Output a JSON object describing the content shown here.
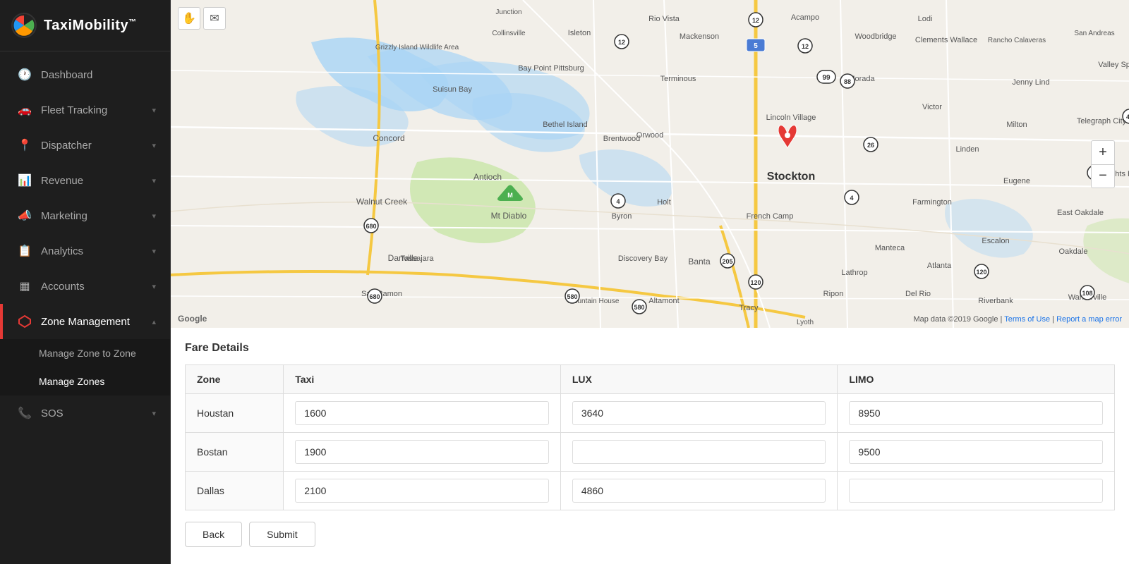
{
  "app": {
    "name": "TaxiMobility",
    "trademark": "™"
  },
  "sidebar": {
    "items": [
      {
        "id": "dashboard",
        "label": "Dashboard",
        "icon": "🕐",
        "active": false,
        "expandable": false
      },
      {
        "id": "fleet-tracking",
        "label": "Fleet Tracking",
        "icon": "🚗",
        "active": false,
        "expandable": true
      },
      {
        "id": "dispatcher",
        "label": "Dispatcher",
        "icon": "📍",
        "active": false,
        "expandable": true
      },
      {
        "id": "revenue",
        "label": "Revenue",
        "icon": "📊",
        "active": false,
        "expandable": true
      },
      {
        "id": "marketing",
        "label": "Marketing",
        "icon": "📣",
        "active": false,
        "expandable": true
      },
      {
        "id": "analytics",
        "label": "Analytics",
        "icon": "📋",
        "active": false,
        "expandable": true
      },
      {
        "id": "accounts",
        "label": "Accounts",
        "icon": "▦",
        "active": false,
        "expandable": true
      },
      {
        "id": "zone-management",
        "label": "Zone Management",
        "icon": "⬡",
        "active": true,
        "expandable": true
      }
    ],
    "sub_items": [
      {
        "id": "manage-zone-to-zone",
        "label": "Manage Zone to Zone",
        "active": false
      },
      {
        "id": "manage-zones",
        "label": "Manage Zones",
        "active": true
      }
    ],
    "sos_item": {
      "id": "sos",
      "label": "SOS",
      "icon": "📞",
      "expandable": true
    }
  },
  "map": {
    "watermark": "Google",
    "credit": "Map data ©2019 Google",
    "terms_link": "Terms of Use",
    "report_link": "Report a map error",
    "pin_city": "Stockton",
    "zoom_in_label": "+",
    "zoom_out_label": "−",
    "tool_hand": "✋",
    "tool_draw": "✉"
  },
  "fare_details": {
    "title": "Fare Details",
    "columns": {
      "zone": "Zone",
      "taxi": "Taxi",
      "lux": "LUX",
      "limo": "LIMO"
    },
    "rows": [
      {
        "zone": "Houstan",
        "taxi": "1600",
        "lux": "3640",
        "limo": "8950"
      },
      {
        "zone": "Bostan",
        "taxi": "1900",
        "lux": "",
        "limo": "9500"
      },
      {
        "zone": "Dallas",
        "taxi": "2100",
        "lux": "4860",
        "limo": ""
      }
    ]
  },
  "actions": {
    "back_label": "Back",
    "submit_label": "Submit"
  }
}
